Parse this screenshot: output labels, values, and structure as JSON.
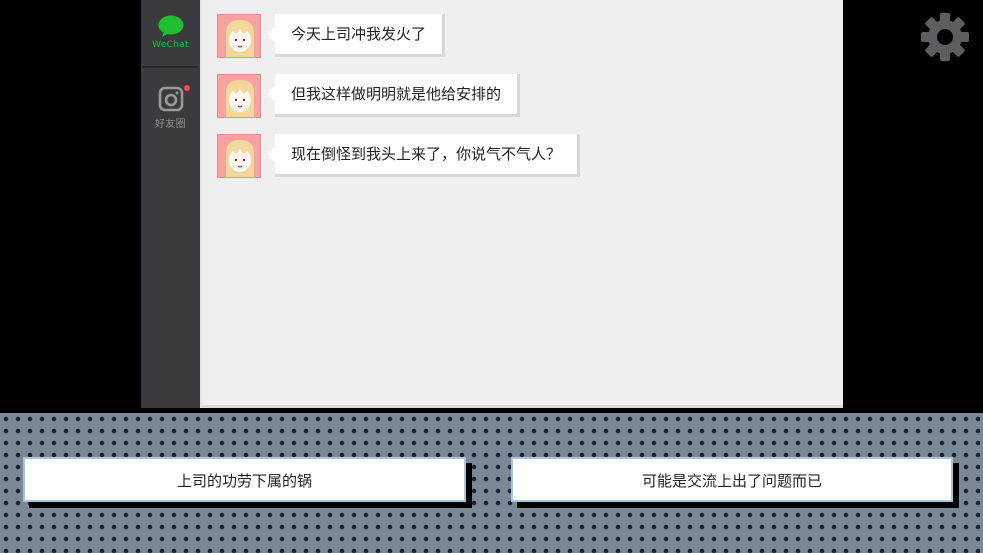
{
  "sidebar": {
    "wechat_label": "WeChat",
    "moments_label": "好友圈"
  },
  "messages": [
    {
      "text": "今天上司冲我发火了"
    },
    {
      "text": "但我这样做明明就是他给安排的"
    },
    {
      "text": "现在倒怪到我头上来了，你说气不气人？"
    }
  ],
  "choices": {
    "left": "上司的功劳下属的锅",
    "right": "可能是交流上出了问题而已"
  },
  "colors": {
    "wechat_green": "#1fbf2f",
    "sidebar_bg": "#3b3b3d",
    "chat_bg": "#efefef",
    "avatar_bg": "#f7a1a1",
    "bottom_bg": "#7b8896",
    "notification_dot": "#ff4d4d"
  },
  "icons": [
    "wechat-icon",
    "camera-icon",
    "settings-gear-icon"
  ]
}
